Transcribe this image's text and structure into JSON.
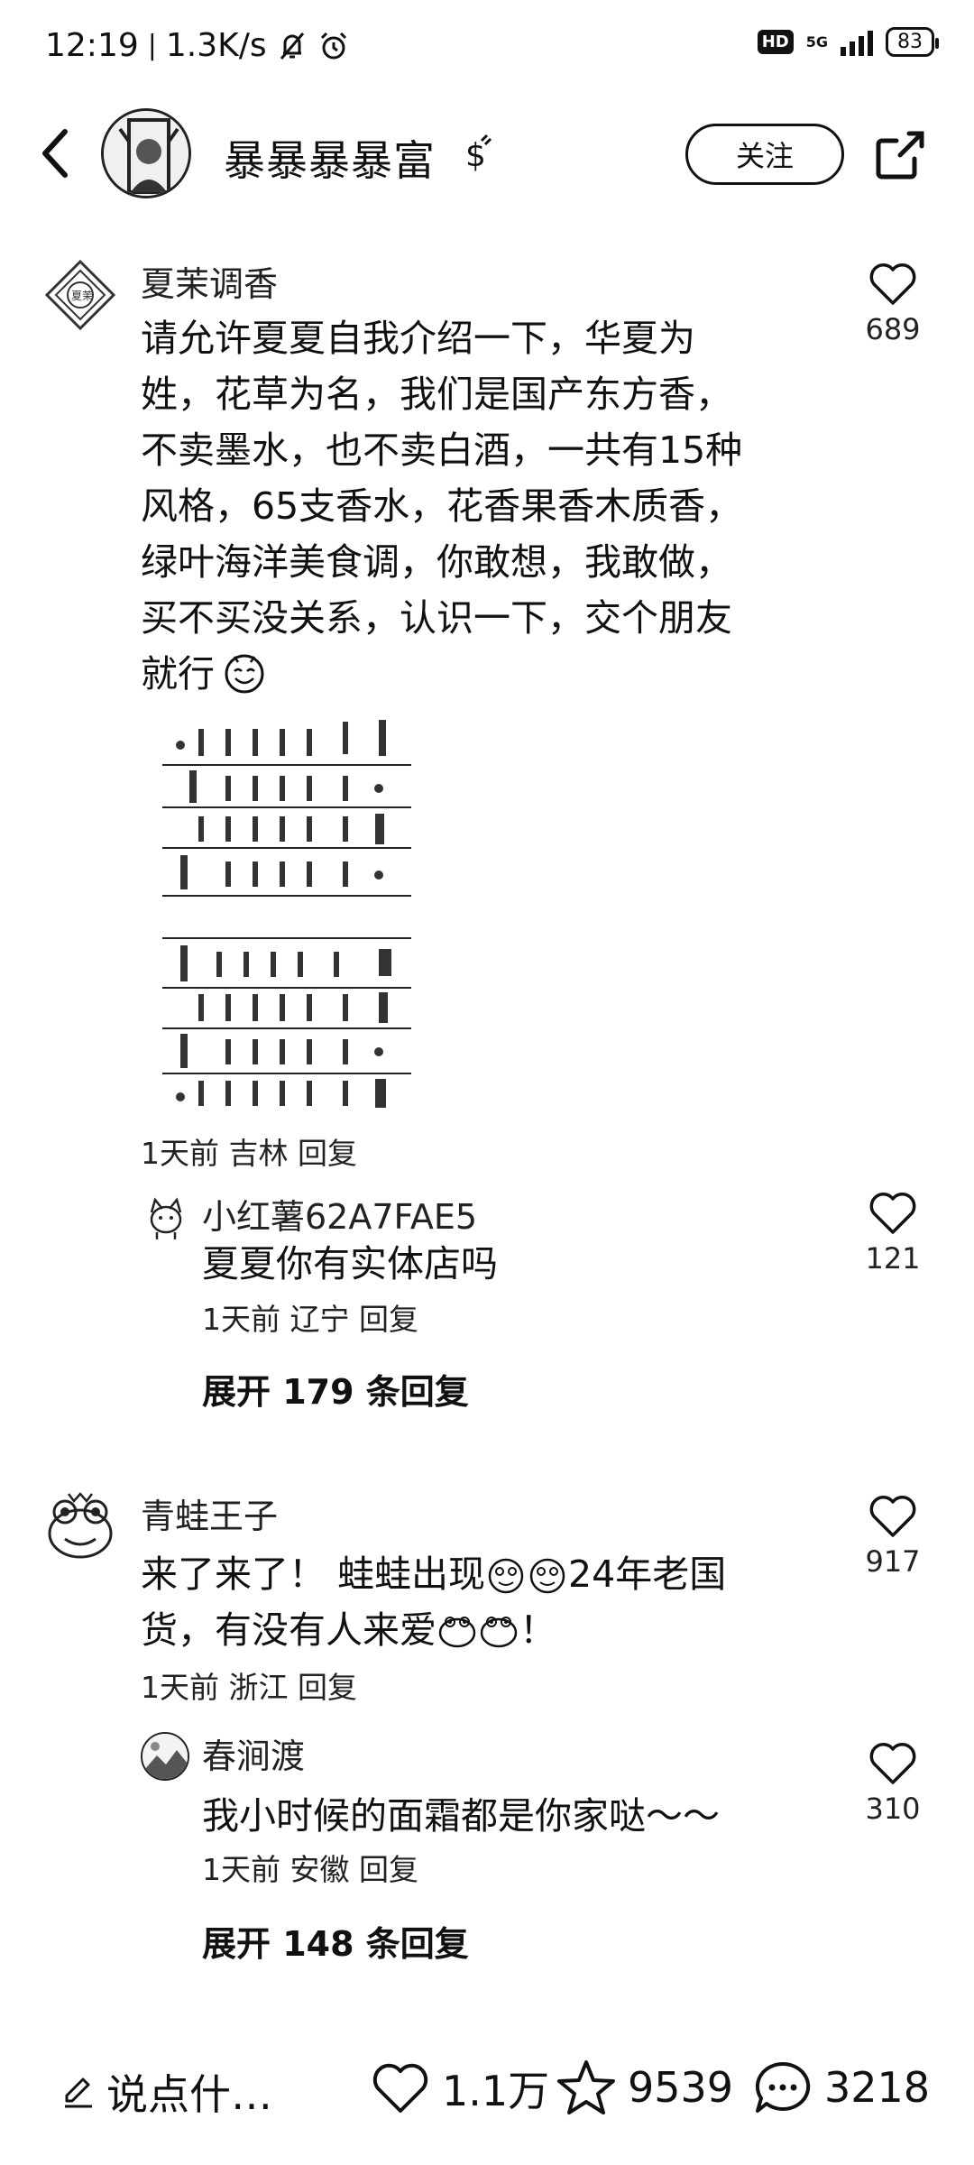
{
  "status_bar": {
    "time": "12:19",
    "speed": "1.3K/s",
    "network": "5G",
    "hd": "HD",
    "battery": "83"
  },
  "header": {
    "title": "暴暴暴暴富",
    "follow_label": "关注"
  },
  "comments": [
    {
      "user": "夏茉调香",
      "text_lines": [
        "请允许夏夏自我介绍一下，华夏为",
        "姓，花草为名，我们是国产东方香，",
        "不卖墨水，也不卖白酒，一共有15种",
        "风格，65支香水，花香果香木质香，",
        "绿叶海洋美食调，你敢想，我敢做，",
        "买不买没关系，认识一下，交个朋友",
        "就行"
      ],
      "meta": "1天前  吉林  回复",
      "likes": "689",
      "replies": [
        {
          "user": "小红薯62A7FAE5",
          "text": "夏夏你有实体店吗",
          "meta": "1天前  辽宁  回复",
          "likes": "121"
        }
      ],
      "expand": "展开 179 条回复"
    },
    {
      "user": "青蛙王子",
      "text_lines": [
        "来了来了！ 蛙蛙出现",
        "24年老国",
        "货，有没有人来爱",
        "！"
      ],
      "meta": "1天前  浙江  回复",
      "likes": "917",
      "replies": [
        {
          "user": "春涧渡",
          "text": "我小时候的面霜都是你家哒～～",
          "meta": "1天前  安徽  回复",
          "likes": "310"
        }
      ],
      "expand": "展开 148 条回复"
    }
  ],
  "bottom_bar": {
    "input_placeholder": "说点什…",
    "likes": "1.1万",
    "favorites": "9539",
    "comments": "3218"
  }
}
